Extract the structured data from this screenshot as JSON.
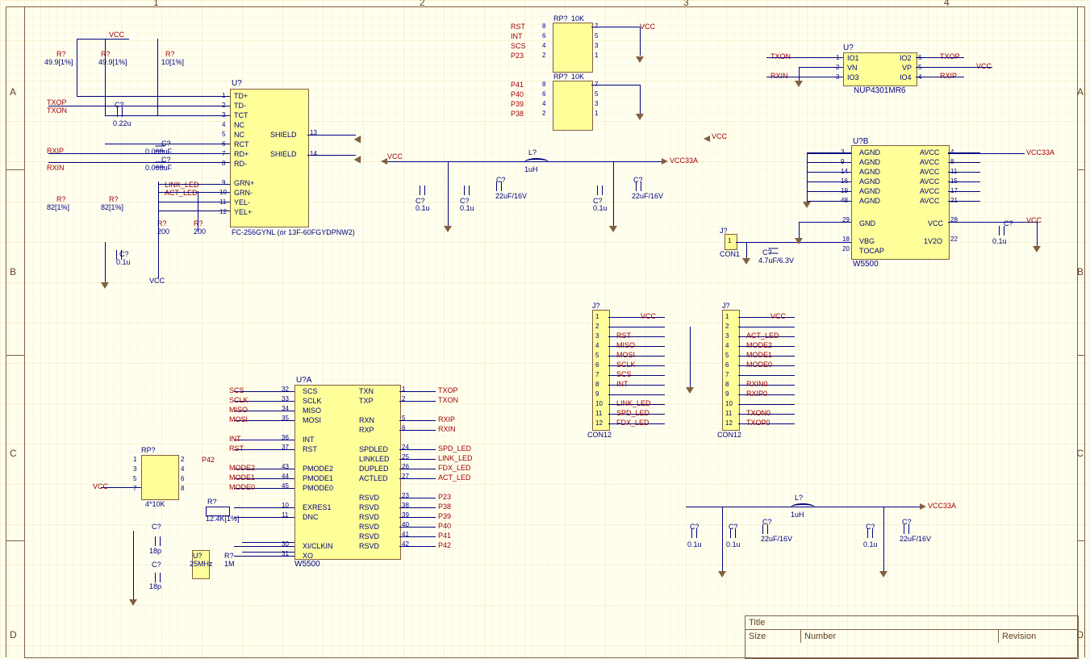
{
  "border": {
    "cols": [
      "1",
      "2",
      "3",
      "4"
    ],
    "rows": [
      "A",
      "B",
      "C",
      "D"
    ]
  },
  "u_jack": {
    "ref": "U?",
    "part": "FC-256GYNL (or 13F-60FGYDPNW2)",
    "left": [
      "TD+",
      "TD-",
      "TCT",
      "NC",
      "NC",
      "RCT",
      "RD+",
      "RD-",
      "",
      "GRN+",
      "GRN-",
      "YEL-",
      "YEL+"
    ],
    "right": [
      "SHIELD",
      "SHIELD"
    ]
  },
  "r1": {
    "ref": "R?",
    "val": "49.9[1%]"
  },
  "r2": {
    "ref": "R?",
    "val": "49.9[1%]"
  },
  "r3": {
    "ref": "R?",
    "val": "10[1%]"
  },
  "r4": {
    "ref": "R?",
    "val": "82[1%]"
  },
  "r5": {
    "ref": "R?",
    "val": "82[1%]"
  },
  "r6": {
    "ref": "R?",
    "val": "200"
  },
  "r7": {
    "ref": "R?",
    "val": "200"
  },
  "r8": {
    "ref": "R?",
    "val": "1M"
  },
  "r9": {
    "ref": "R?",
    "val": "12.4K[1%]"
  },
  "c1": {
    "ref": "C?",
    "val": "0.22u"
  },
  "c2": {
    "ref": "C?",
    "val": "0.068uF"
  },
  "c3": {
    "ref": "C?",
    "val": "0.068uF"
  },
  "c4": {
    "ref": "C?",
    "val": "0.1u"
  },
  "c5": {
    "ref": "C?",
    "val": "0.1u"
  },
  "c6": {
    "ref": "C?",
    "val": "0.1u"
  },
  "c7": {
    "ref": "C?",
    "val": "22uF/16V"
  },
  "c8": {
    "ref": "C?",
    "val": "0.1u"
  },
  "c9": {
    "ref": "C?",
    "val": "22uF/16V"
  },
  "c10": {
    "ref": "C?",
    "val": "0.1u"
  },
  "c11": {
    "ref": "C?",
    "val": "4.7uF/6.3V"
  },
  "c12": {
    "ref": "C?",
    "val": "18p"
  },
  "c13": {
    "ref": "C?",
    "val": "18p"
  },
  "c14": {
    "ref": "C?",
    "val": "0.1u"
  },
  "c15": {
    "ref": "C?",
    "val": "0.1u"
  },
  "c16": {
    "ref": "C?",
    "val": "22uF/16V"
  },
  "c17": {
    "ref": "C?",
    "val": "0.1u"
  },
  "c18": {
    "ref": "C?",
    "val": "22uF/16V"
  },
  "l1": {
    "ref": "L?",
    "val": "1uH"
  },
  "l2": {
    "ref": "L?",
    "val": "1uH"
  },
  "rp1": {
    "ref": "RP?",
    "val": "10K",
    "nets": [
      "RST",
      "INT",
      "SCS",
      "P23"
    ]
  },
  "rp2": {
    "ref": "RP?",
    "val": "10K",
    "nets": [
      "P41",
      "P40",
      "P39",
      "P38"
    ]
  },
  "rp3": {
    "ref": "RP?",
    "val": "4*10K",
    "net": "P42"
  },
  "u_nup": {
    "ref": "U?",
    "part": "NUP4301MR6",
    "pins": {
      "io1": "IO1",
      "io2": "IO2",
      "vn": "VN",
      "vp": "VP",
      "io3": "IO3",
      "io4": "IO4"
    },
    "nets": {
      "txon": "TXON",
      "rxin": "RXIN",
      "txop": "TXOP",
      "rxip": "RXIP",
      "vcc": "VCC"
    }
  },
  "ub": {
    "ref": "U?B",
    "part": "W5500",
    "agnd": "AGND",
    "avcc": "AVCC",
    "gnd": "GND",
    "vcc": "VCC",
    "vbg": "VBG",
    "tocap": "TOCAP",
    "v12": "1V2O",
    "net_vcc33": "VCC33A",
    "net_vcc": "VCC"
  },
  "con1": {
    "ref": "J?",
    "part": "CON1",
    "pin": "1"
  },
  "ua": {
    "ref": "U?A",
    "part": "W5500",
    "left": [
      "SCS",
      "SCLK",
      "MISO",
      "MOSI",
      "",
      "INT",
      "RST",
      "",
      "PMODE2",
      "PMODE1",
      "PMODE0",
      "",
      "EXRES1",
      "DNC",
      "",
      "",
      "XI/CLKIN",
      "XO"
    ],
    "right": [
      "TXN",
      "TXP",
      "",
      "RXN",
      "RXP",
      "",
      "SPDLED",
      "LINKLED",
      "DUPLED",
      "ACTLED",
      "",
      "RSVD",
      "RSVD",
      "RSVD",
      "RSVD",
      "RSVD",
      "RSVD"
    ],
    "lpins": [
      "32",
      "33",
      "34",
      "35",
      "",
      "36",
      "37",
      "",
      "43",
      "44",
      "45",
      "",
      "10",
      "11",
      "",
      "",
      "30",
      "31"
    ],
    "rpins": [
      "1",
      "2",
      "",
      "5",
      "6",
      "",
      "24",
      "25",
      "26",
      "27",
      "",
      "23",
      "38",
      "39",
      "40",
      "41",
      "42"
    ],
    "lnets": [
      "SCS",
      "SCLK",
      "MISO",
      "MOSI",
      "",
      "INT",
      "RST",
      "",
      "MODE2",
      "MODE1",
      "MODE0"
    ],
    "rnets": [
      "TXOP",
      "TXON",
      "",
      "RXIP",
      "RXIN",
      "",
      "SPD_LED",
      "LINK_LED",
      "FDX_LED",
      "ACT_LED",
      "",
      "P23",
      "P38",
      "P39",
      "P40",
      "P41",
      "P42"
    ]
  },
  "j1": {
    "ref": "J?",
    "part": "CON12",
    "pins": [
      "1",
      "2",
      "3",
      "4",
      "5",
      "6",
      "7",
      "8",
      "9",
      "10",
      "11",
      "12"
    ],
    "nets": [
      "VCC",
      "",
      "RST",
      "MISO",
      "MOSI",
      "SCLK",
      "SCS",
      "INT",
      "",
      "LINK_LED",
      "SPD_LED",
      "FDX_LED"
    ]
  },
  "j2": {
    "ref": "J?",
    "part": "CON12",
    "pins": [
      "1",
      "2",
      "3",
      "4",
      "5",
      "6",
      "7",
      "8",
      "9",
      "10",
      "11",
      "12"
    ],
    "nets": [
      "VCC",
      "",
      "ACT_LED",
      "MODE2",
      "MODE1",
      "MODE0",
      "",
      "RXIN0",
      "RXIP0",
      "",
      "TXON0",
      "TXOP0"
    ]
  },
  "y1": {
    "ref": "U?",
    "val": "25MHz"
  },
  "top_nets": {
    "txop": "TXOP",
    "txon": "TXON",
    "rxip": "RXIP",
    "rxin": "RXIN",
    "vcc": "VCC",
    "link": "LINK_LED",
    "act": "ACT_LED"
  },
  "pwr": {
    "vcc": "VCC",
    "vcc33": "VCC33A"
  },
  "title": {
    "title": "Title",
    "size": "Size",
    "num": "Number",
    "rev": "Revision"
  }
}
